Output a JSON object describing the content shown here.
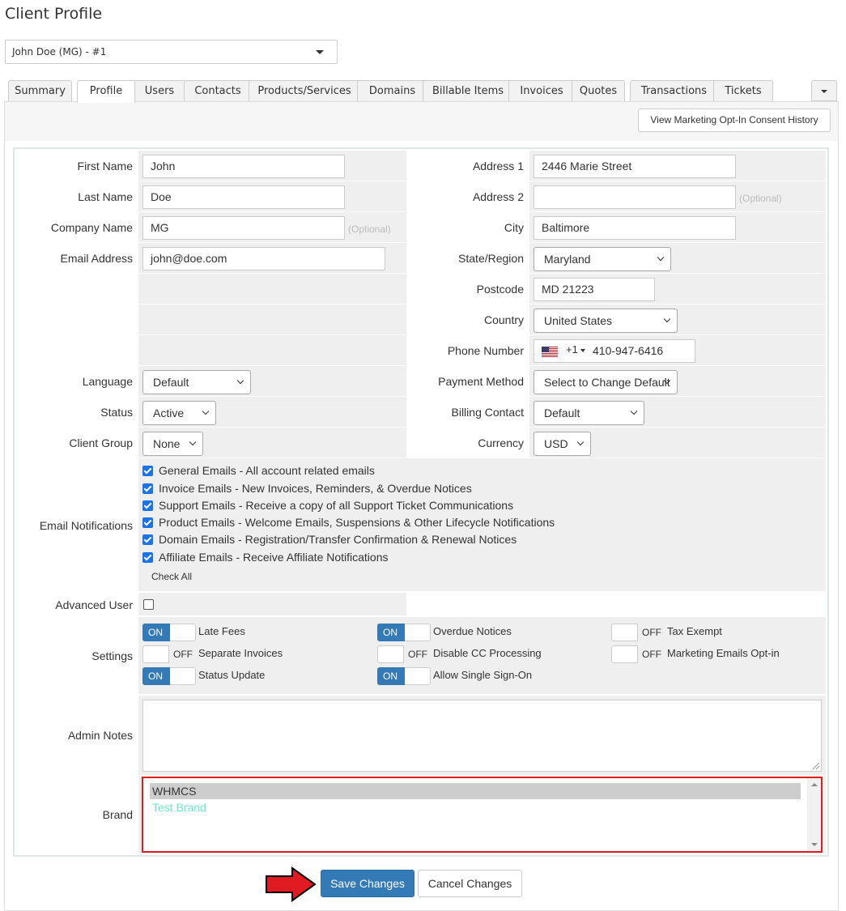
{
  "page": {
    "title": "Client Profile",
    "client_selector": "John Doe (MG) - #1"
  },
  "tabs": [
    "Summary",
    "Profile",
    "Users",
    "Contacts",
    "Products/Services",
    "Domains",
    "Billable Items",
    "Invoices",
    "Quotes",
    "Transactions",
    "Tickets"
  ],
  "active_tab": "Profile",
  "consent_button": "View Marketing Opt-In Consent History",
  "form": {
    "first_name": {
      "label": "First Name",
      "value": "John"
    },
    "last_name": {
      "label": "Last Name",
      "value": "Doe"
    },
    "company_name": {
      "label": "Company Name",
      "value": "MG",
      "hint": "(Optional)"
    },
    "email": {
      "label": "Email Address",
      "value": "john@doe.com"
    },
    "address1": {
      "label": "Address 1",
      "value": "2446 Marie Street"
    },
    "address2": {
      "label": "Address 2",
      "value": "",
      "hint": "(Optional)"
    },
    "city": {
      "label": "City",
      "value": "Baltimore"
    },
    "state": {
      "label": "State/Region",
      "value": "Maryland"
    },
    "postcode": {
      "label": "Postcode",
      "value": "MD 21223"
    },
    "country": {
      "label": "Country",
      "value": "United States"
    },
    "phone": {
      "label": "Phone Number",
      "dial_code": "+1",
      "value": "410-947-6416"
    },
    "language": {
      "label": "Language",
      "value": "Default"
    },
    "payment_method": {
      "label": "Payment Method",
      "value": "Select to Change Default"
    },
    "status": {
      "label": "Status",
      "value": "Active"
    },
    "billing_contact": {
      "label": "Billing Contact",
      "value": "Default"
    },
    "client_group": {
      "label": "Client Group",
      "value": "None"
    },
    "currency": {
      "label": "Currency",
      "value": "USD"
    }
  },
  "email_notifications": {
    "label": "Email Notifications",
    "items": [
      "General Emails - All account related emails",
      "Invoice Emails - New Invoices, Reminders, & Overdue Notices",
      "Support Emails - Receive a copy of all Support Ticket Communications",
      "Product Emails - Welcome Emails, Suspensions & Other Lifecycle Notifications",
      "Domain Emails - Registration/Transfer Confirmation & Renewal Notices",
      "Affiliate Emails - Receive Affiliate Notifications"
    ],
    "check_all": "Check All"
  },
  "advanced_user": {
    "label": "Advanced User"
  },
  "settings": {
    "label": "Settings",
    "on_text": "ON",
    "off_text": "OFF",
    "toggles": [
      {
        "label": "Late Fees",
        "state": "on"
      },
      {
        "label": "Overdue Notices",
        "state": "on"
      },
      {
        "label": "Tax Exempt",
        "state": "off"
      },
      {
        "label": "Separate Invoices",
        "state": "off"
      },
      {
        "label": "Disable CC Processing",
        "state": "off"
      },
      {
        "label": "Marketing Emails Opt-in",
        "state": "off"
      },
      {
        "label": "Status Update",
        "state": "on"
      },
      {
        "label": "Allow Single Sign-On",
        "state": "on"
      }
    ]
  },
  "admin_notes": {
    "label": "Admin Notes"
  },
  "brand": {
    "label": "Brand",
    "options": [
      "WHMCS",
      "Test Brand"
    ]
  },
  "actions": {
    "save": "Save Changes",
    "cancel": "Cancel Changes"
  },
  "colors": {
    "primary": "#337ab7",
    "highlight_border": "#e01b22",
    "arrow": "#e01b22",
    "checkbox": "#1a73e8",
    "test_brand": "#66e8c9"
  }
}
